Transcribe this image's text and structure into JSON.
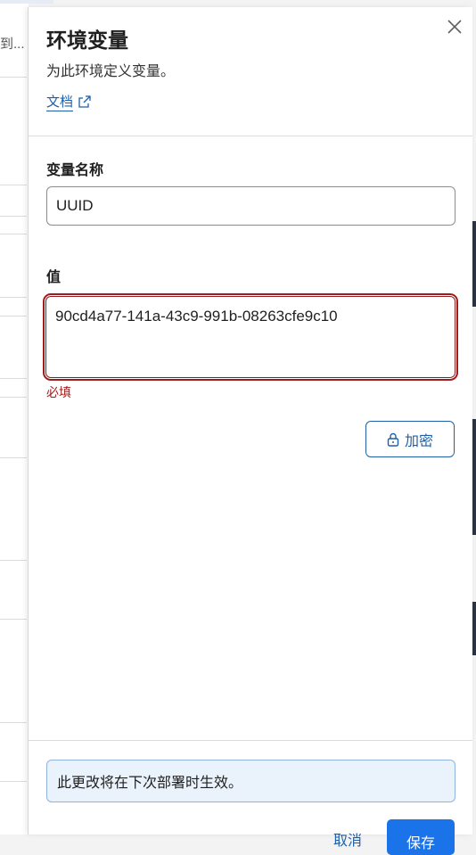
{
  "background": {
    "truncated_text": "到..."
  },
  "panel": {
    "title": "环境变量",
    "description": "为此环境定义变量。",
    "doc_link": "文档"
  },
  "form": {
    "name_label": "变量名称",
    "name_value": "UUID",
    "value_label": "值",
    "value_value": "90cd4a77-141a-43c9-991b-08263cfe9c10",
    "required_message": "必填",
    "encrypt_label": "加密"
  },
  "footer": {
    "info_text": "此更改将在下次部署时生效。",
    "cancel_label": "取消",
    "save_label": "保存"
  },
  "colors": {
    "accent": "#1f5fa8",
    "error": "#a01c1c",
    "info_bg": "#eaf2fc"
  }
}
